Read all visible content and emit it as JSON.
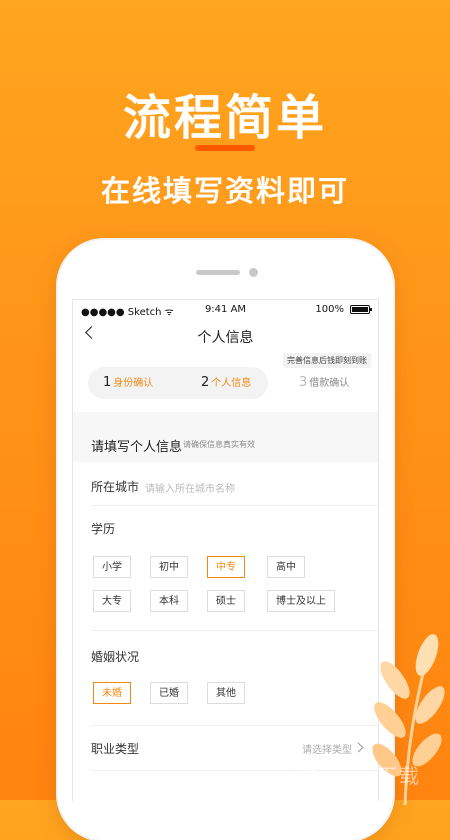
{
  "promo": {
    "title": "流程简单",
    "subtitle": "在线填写资料即可"
  },
  "status_bar": {
    "carrier": "●●●●● Sketch ᯤ",
    "time": "9:41 AM",
    "battery": "100%"
  },
  "nav": {
    "title": "个人信息"
  },
  "steps": {
    "hint": "完善信息后钱即刻到账",
    "items": [
      {
        "num": "1",
        "label": "身份确认"
      },
      {
        "num": "2",
        "label": "个人信息"
      },
      {
        "num": "3",
        "label": "借款确认"
      }
    ]
  },
  "form": {
    "header_title": "请填写个人信息",
    "header_subtitle": "请确保信息真实有效",
    "city": {
      "label": "所在城市",
      "placeholder": "请输入所在城市名称"
    },
    "education": {
      "label": "学历",
      "options": [
        "小学",
        "初中",
        "中专",
        "高中",
        "大专",
        "本科",
        "硕士",
        "博士及以上"
      ],
      "selected": "中专"
    },
    "marital": {
      "label": "婚姻状况",
      "options": [
        "未婚",
        "已婚",
        "其他"
      ],
      "selected": "未婚"
    },
    "occupation": {
      "label": "职业类型",
      "placeholder": "请选择类型"
    }
  },
  "watermark": {
    "icon_glyph": "听",
    "text": "一听下载"
  },
  "colors": {
    "accent": "#f08a13",
    "background_top": "#ffa51f",
    "background_bottom": "#ff8410",
    "underline": "#ff5a00"
  }
}
